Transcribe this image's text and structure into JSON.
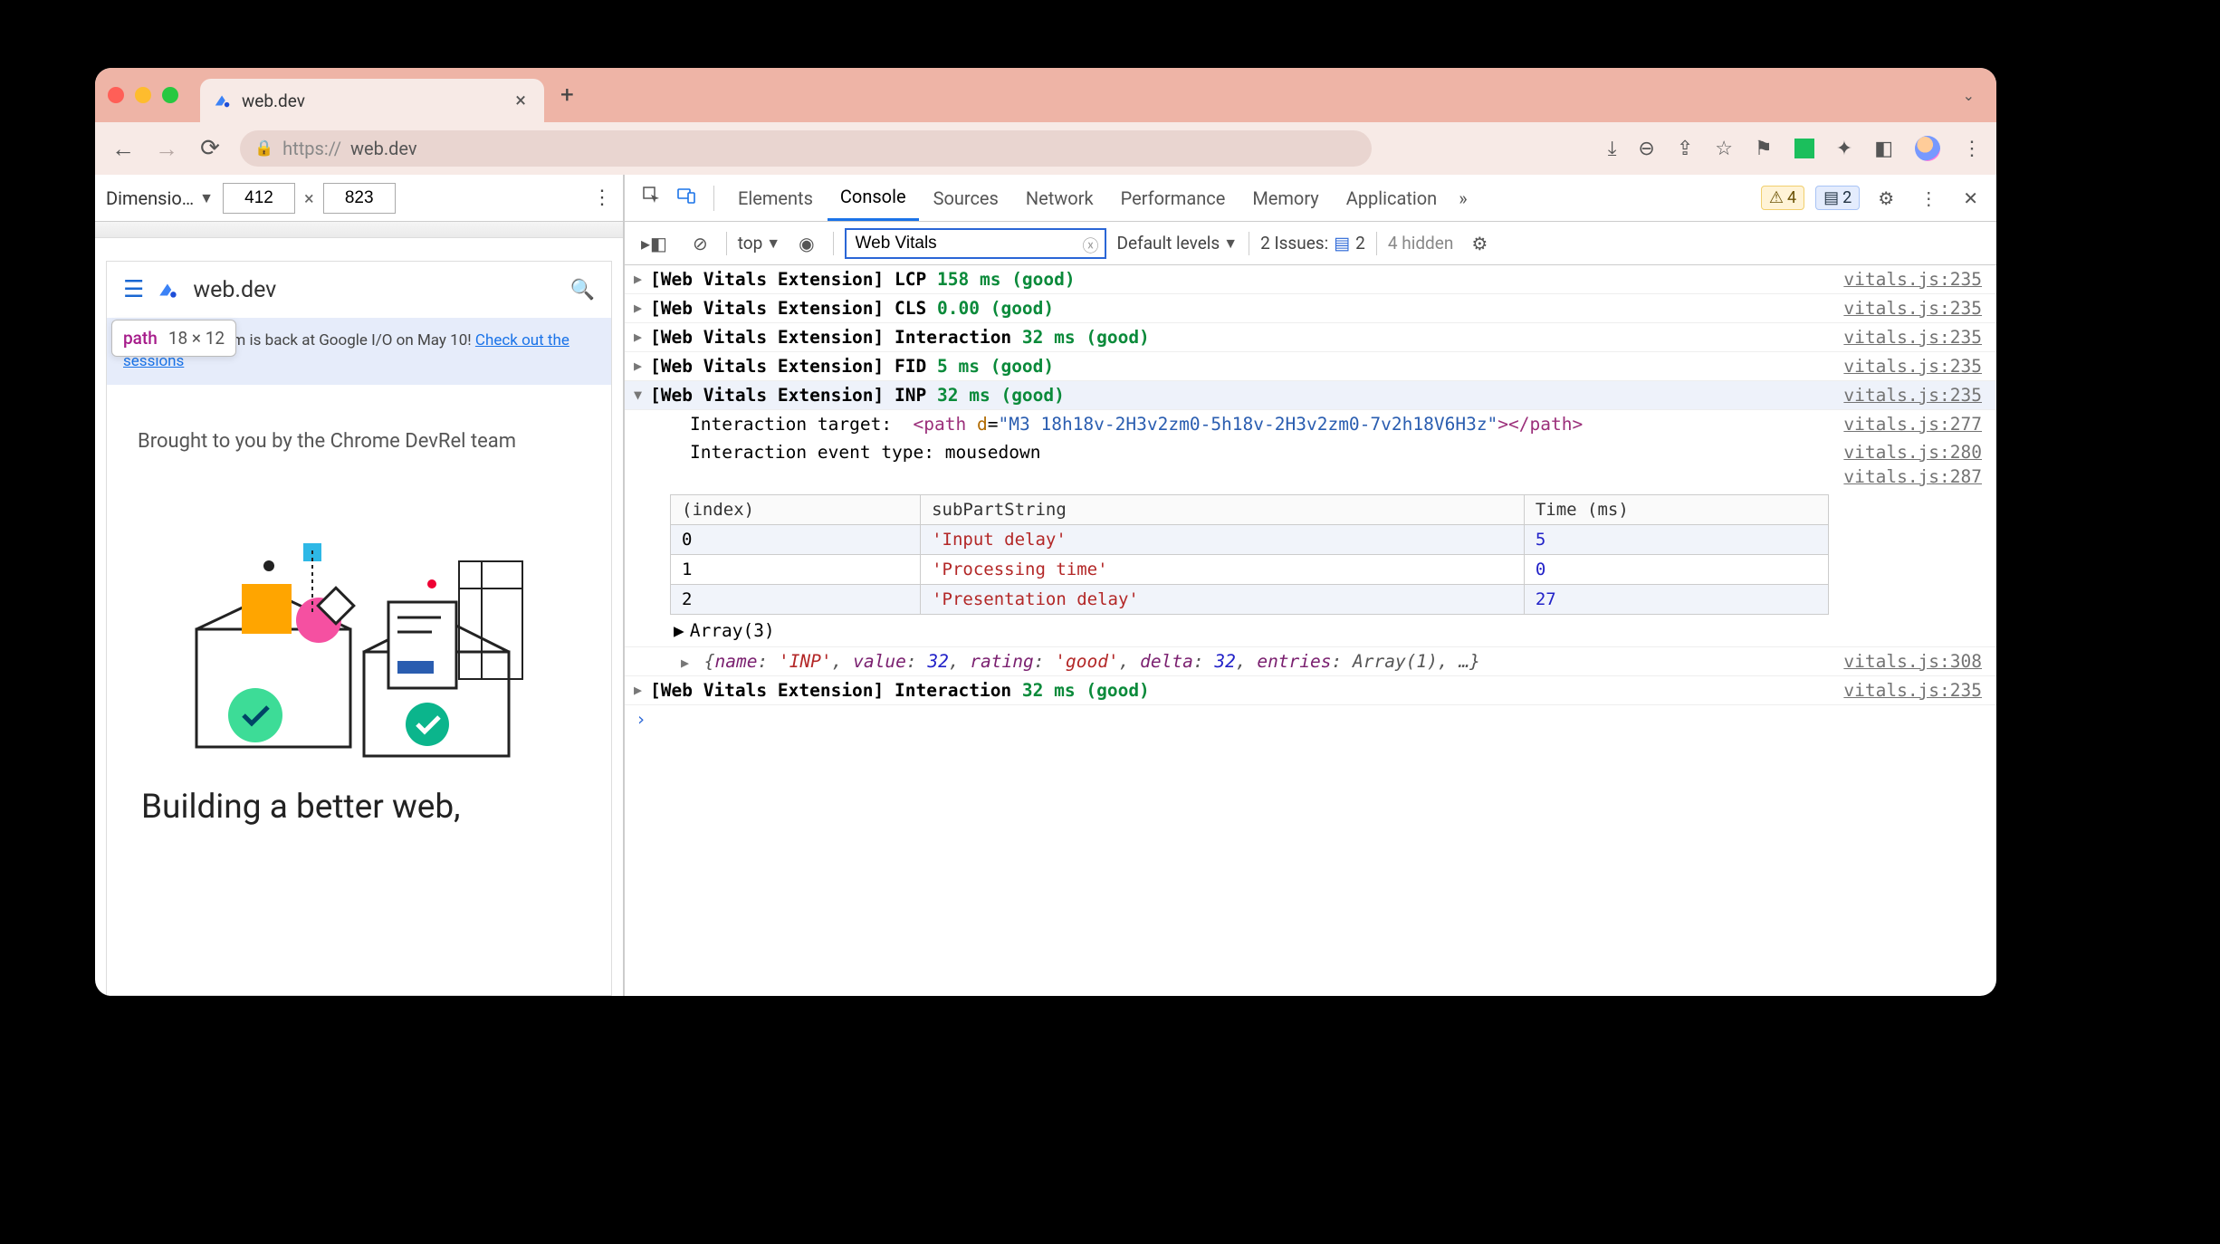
{
  "browser": {
    "tab_title": "web.dev",
    "url_scheme": "https://",
    "url_host": "web.dev",
    "new_tab": "+",
    "close_tab": "×"
  },
  "device_toolbar": {
    "label": "Dimensio…",
    "width": "412",
    "height": "823",
    "times": "×"
  },
  "inspect_tip": {
    "element": "path",
    "dimensions": "18 × 12"
  },
  "site": {
    "title": "web.dev",
    "banner_text": "The Chrome team is back at Google I/O on May 10! ",
    "banner_link": "Check out the sessions",
    "brought": "Brought to you by the Chrome DevRel team",
    "headline": "Building a better web,"
  },
  "devtools": {
    "tabs": [
      "Elements",
      "Console",
      "Sources",
      "Network",
      "Performance",
      "Memory",
      "Application"
    ],
    "active_tab": "Console",
    "warning_count": "4",
    "info_count": "2",
    "context": "top",
    "filter": "Web Vitals",
    "levels": "Default levels",
    "issues_label": "2 Issues:",
    "issues_count": "2",
    "hidden": "4 hidden"
  },
  "logs": [
    {
      "prefix": "[Web Vitals Extension]",
      "metric": "LCP",
      "value": "158 ms (good)",
      "src": "vitals.js:235"
    },
    {
      "prefix": "[Web Vitals Extension]",
      "metric": "CLS",
      "value": "0.00 (good)",
      "src": "vitals.js:235"
    },
    {
      "prefix": "[Web Vitals Extension]",
      "metric": "Interaction",
      "value": "32 ms (good)",
      "src": "vitals.js:235"
    },
    {
      "prefix": "[Web Vitals Extension]",
      "metric": "FID",
      "value": "5 ms (good)",
      "src": "vitals.js:235"
    },
    {
      "prefix": "[Web Vitals Extension]",
      "metric": "INP",
      "value": "32 ms (good)",
      "src": "vitals.js:235"
    }
  ],
  "expanded": {
    "target_label": "Interaction target:",
    "target_markup": {
      "tag": "path",
      "attr": "d",
      "val": "\"M3 18h18v-2H3v2zm0-5h18v-2H3v2zm0-7v2h18V6H3z\""
    },
    "target_src": "vitals.js:277",
    "event_label": "Interaction event type:",
    "event_value": "mousedown",
    "event_src": "vitals.js:280",
    "table_src": "vitals.js:287",
    "table_headers": [
      "(index)",
      "subPartString",
      "Time (ms)"
    ],
    "table_rows": [
      {
        "i": "0",
        "s": "'Input delay'",
        "t": "5"
      },
      {
        "i": "1",
        "s": "'Processing time'",
        "t": "0"
      },
      {
        "i": "2",
        "s": "'Presentation delay'",
        "t": "27"
      }
    ],
    "array_label": "Array(3)",
    "obj_summary_raw": "{name: 'INP', value: 32, rating: 'good', delta: 32, entries: Array(1), …}",
    "obj_src": "vitals.js:308"
  },
  "last_log": {
    "prefix": "[Web Vitals Extension]",
    "metric": "Interaction",
    "value": "32 ms (good)",
    "src": "vitals.js:235"
  }
}
